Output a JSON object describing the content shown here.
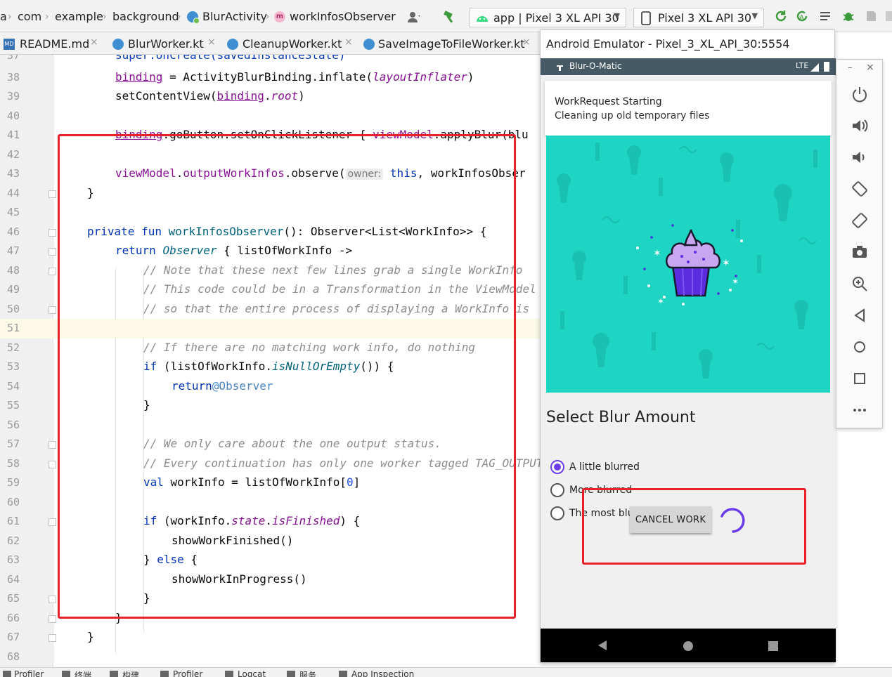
{
  "navbar": {
    "breadcrumbs": [
      "a",
      "com",
      "example",
      "background",
      "BlurActivity",
      "workInfosObserver"
    ],
    "run_config": "app | Pixel 3 XL API 30",
    "device": "Pixel 3 XL API 30"
  },
  "tabs": [
    {
      "label": "README.md",
      "icon": "markdown-file-icon"
    },
    {
      "label": "BlurWorker.kt",
      "icon": "kotlin-class-icon"
    },
    {
      "label": "CleanupWorker.kt",
      "icon": "kotlin-class-icon"
    },
    {
      "label": "SaveImageToFileWorker.kt",
      "icon": "kotlin-class-icon"
    }
  ],
  "editor": {
    "line_numbers": [
      "37",
      "38",
      "39",
      "40",
      "41",
      "42",
      "43",
      "44",
      "45",
      "46",
      "47",
      "48",
      "49",
      "50",
      "51",
      "52",
      "53",
      "54",
      "55",
      "56",
      "57",
      "58",
      "59",
      "60",
      "61",
      "62",
      "63",
      "64",
      "65",
      "66",
      "67",
      "68"
    ],
    "active_line": "51",
    "hint_owner": "owner:",
    "code": {
      "l37": "super.onCreate(savedInstanceState)",
      "l38_a": "binding",
      "l38_b": " = ActivityBlurBinding.inflate(",
      "l38_c": "layoutInflater",
      "l38_d": ")",
      "l39_a": "setContentView(",
      "l39_b": "binding",
      "l39_c": ".",
      "l39_d": "root",
      "l39_e": ")",
      "l41_a": "binding",
      "l41_b": ".goButton.setOnClickListener { ",
      "l41_c": "viewModel",
      "l41_d": ".applyBlur(blu",
      "l43_a": "viewModel",
      "l43_b": ".",
      "l43_c": "outputWorkInfos",
      "l43_d": ".observe(",
      "l43_e": "this",
      "l43_f": ", workInfosObser",
      "l44": "}",
      "l46_a": "private fun ",
      "l46_b": "workInfosObserver",
      "l46_c": "(): Observer<List<WorkInfo>> {",
      "l47_a": "return ",
      "l47_b": "Observer",
      "l47_c": " { listOfWorkInfo ->",
      "l48": "// Note that these next few lines grab a single WorkInfo",
      "l49": "// This code could be in a Transformation in the ViewModel",
      "l50": "// so that the entire process of displaying a WorkInfo is",
      "l52": "// If there are no matching work info, do nothing",
      "l53_a": "if",
      "l53_b": " (listOfWorkInfo.",
      "l53_c": "isNullOrEmpty",
      "l53_d": "()) {",
      "l54_a": "return",
      "l54_b": "@Observer",
      "l55": "}",
      "l57": "// We only care about the one output status.",
      "l58": "// Every continuation has only one worker tagged TAG_OUTPUT",
      "l59_a": "val",
      "l59_b": " workInfo = listOfWorkInfo[",
      "l59_c": "0",
      "l59_d": "]",
      "l61_a": "if",
      "l61_b": " (workInfo.",
      "l61_c": "state",
      "l61_d": ".",
      "l61_e": "isFinished",
      "l61_f": ") {",
      "l62": "showWorkFinished()",
      "l63_a": "} ",
      "l63_b": "else",
      "l63_c": " {",
      "l64": "showWorkInProgress()",
      "l65": "}",
      "l66": "}",
      "l67": "}"
    }
  },
  "emulator": {
    "title": "Android Emulator - Pixel_3_XL_API_30:5554",
    "status_bar": {
      "app_name": "Blur-O-Matic",
      "network": "LTE"
    },
    "notification": {
      "title": "WorkRequest Starting",
      "text": "Cleaning up old temporary files"
    },
    "heading": "Select Blur Amount",
    "options": [
      {
        "label": "A little blurred",
        "checked": true
      },
      {
        "label": "More blurred",
        "checked": false
      },
      {
        "label": "The most blurred",
        "checked": false
      }
    ],
    "cancel_button": "CANCEL WORK",
    "side_toolbar": [
      "power-icon",
      "volume-up-icon",
      "volume-down-icon",
      "rotate-left-icon",
      "rotate-right-icon",
      "camera-icon",
      "zoom-icon",
      "back-icon",
      "home-icon",
      "overview-icon",
      "more-icon"
    ]
  },
  "colors": {
    "accent_purple": "#6a3de8",
    "hero_teal": "#1ed5c3",
    "annotation_red": "#e8222b",
    "phone_status": "#455a64"
  },
  "bottombar": {
    "items": [
      "Profiler",
      "终端",
      "构建",
      "Profiler",
      "Logcat",
      "服务",
      "App Inspection"
    ]
  }
}
